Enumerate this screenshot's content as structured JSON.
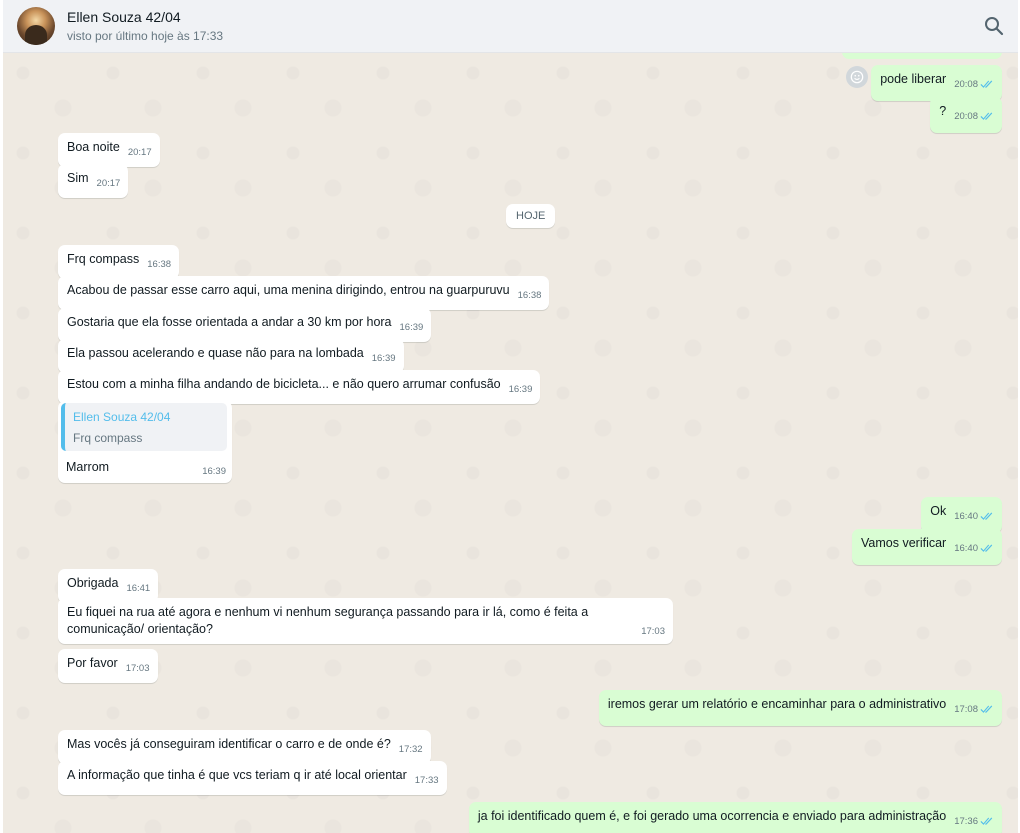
{
  "header": {
    "name": "Ellen Souza 42/04",
    "status": "visto por último hoje às 17:33",
    "search_icon": "search-icon"
  },
  "colors": {
    "incoming": "#ffffff",
    "outgoing": "#d9fdd3",
    "background": "#efeae2",
    "read_ticks": "#53bdeb"
  },
  "date_divider": "HOJE",
  "messages": [
    {
      "dir": "out",
      "text": "pode liberar",
      "time": "20:08"
    },
    {
      "dir": "out",
      "text": "?",
      "time": "20:08"
    },
    {
      "dir": "in",
      "text": "Boa noite",
      "time": "20:17"
    },
    {
      "dir": "in",
      "text": "Sim",
      "time": "20:17"
    },
    {
      "dir": "in",
      "text": "Frq compass",
      "time": "16:38"
    },
    {
      "dir": "in",
      "text": "Acabou de passar esse carro aqui, uma menina dirigindo, entrou na guarpuruvu",
      "time": "16:38"
    },
    {
      "dir": "in",
      "text": "Gostaria que ela fosse orientada a andar a 30 km por hora",
      "time": "16:39"
    },
    {
      "dir": "in",
      "text": "Ela passou acelerando e quase não para na lombada",
      "time": "16:39"
    },
    {
      "dir": "in",
      "text": "Estou com a minha filha andando de bicicleta... e não quero arrumar confusão",
      "time": "16:39"
    },
    {
      "dir": "in",
      "quote_author": "Ellen Souza 42/04",
      "quote_text": "Frq compass",
      "text": "Marrom",
      "time": "16:39"
    },
    {
      "dir": "out",
      "text": "Ok",
      "time": "16:40"
    },
    {
      "dir": "out",
      "text": "Vamos verificar",
      "time": "16:40"
    },
    {
      "dir": "in",
      "text": "Obrigada",
      "time": "16:41"
    },
    {
      "dir": "in",
      "text": "Eu fiquei na rua até agora e nenhum vi nenhum segurança passando para ir lá, como é feita a comunicação/ orientação?",
      "time": "17:03"
    },
    {
      "dir": "in",
      "text": "Por favor",
      "time": "17:03"
    },
    {
      "dir": "out",
      "text": "iremos gerar um relatório e encaminhar para o administrativo",
      "time": "17:08"
    },
    {
      "dir": "in",
      "text": "Mas vocês já conseguiram identificar o carro e de onde é?",
      "time": "17:32"
    },
    {
      "dir": "in",
      "text": "A informação que tinha é que vcs teriam q ir até local orientar",
      "time": "17:33"
    },
    {
      "dir": "out",
      "text": "ja foi identificado quem é, e foi gerado uma ocorrencia e enviado para administração",
      "time": "17:36"
    }
  ]
}
